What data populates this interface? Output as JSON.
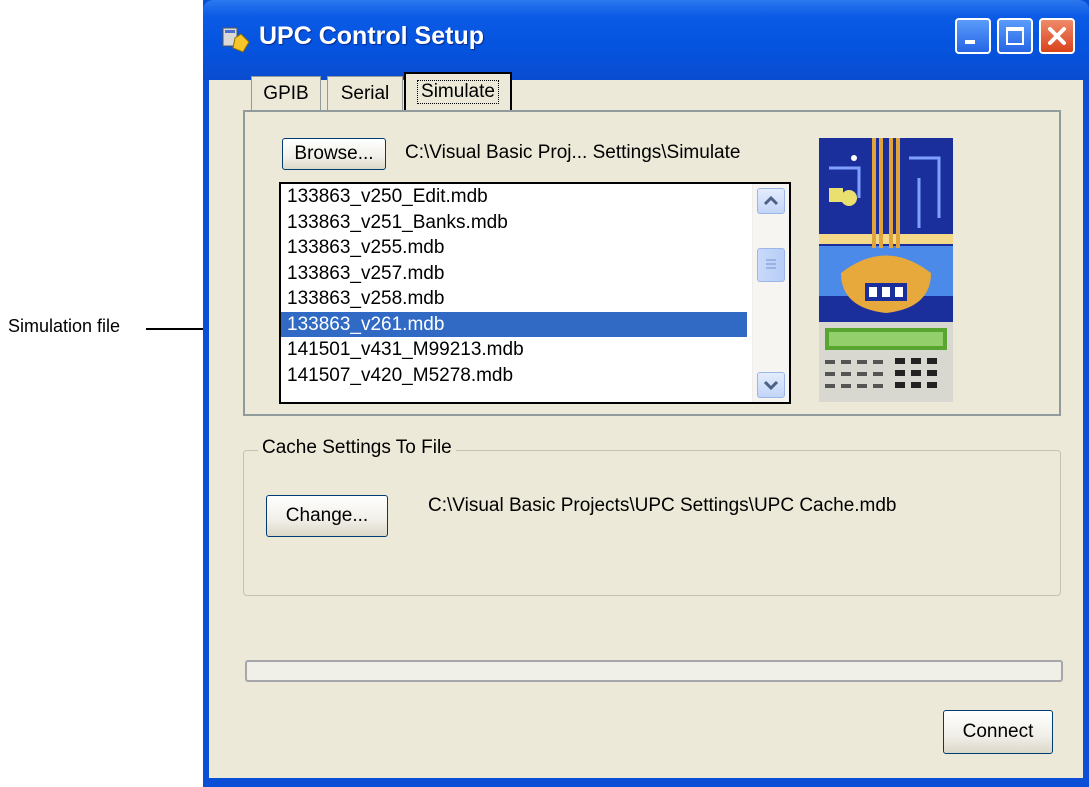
{
  "annotation": {
    "label": "Simulation file"
  },
  "window": {
    "title": "UPC Control Setup",
    "tabs": [
      {
        "label": "GPIB",
        "selected": false
      },
      {
        "label": "Serial",
        "selected": false
      },
      {
        "label": "Simulate",
        "selected": true
      }
    ]
  },
  "simulate": {
    "browse_label": "Browse...",
    "folder_path": "C:\\Visual Basic Proj... Settings\\Simulate",
    "files": [
      "133863_v250_Edit.mdb",
      "133863_v251_Banks.mdb",
      "133863_v255.mdb",
      "133863_v257.mdb",
      "133863_v258.mdb",
      "133863_v261.mdb",
      "141501_v431_M99213.mdb",
      "141507_v420_M5278.mdb"
    ],
    "selected_file": "133863_v261.mdb"
  },
  "cache": {
    "group_label": "Cache Settings To File",
    "change_label": "Change...",
    "file_path": "C:\\Visual Basic Projects\\UPC Settings\\UPC Cache.mdb"
  },
  "progress": {
    "value": 0
  },
  "connect_label": "Connect",
  "colors": {
    "title_bar": "#0454e0",
    "selection": "#316ac5",
    "dialog_bg": "#ece9d8"
  }
}
